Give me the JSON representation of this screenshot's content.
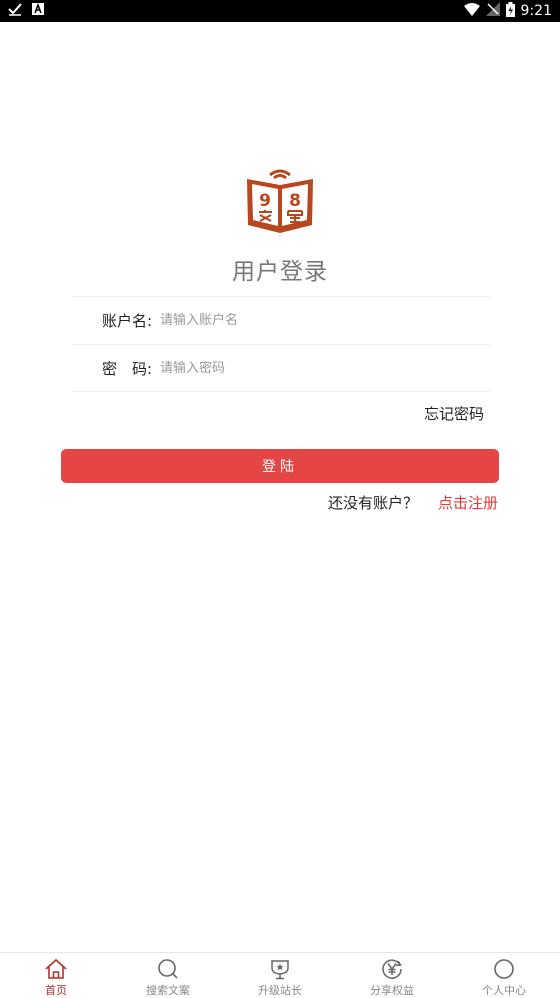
{
  "status_bar": {
    "time": "9:21"
  },
  "page": {
    "title": "用户登录"
  },
  "form": {
    "username_label": "账户名:",
    "username_placeholder": "请输入账户名",
    "password_label": "密　码:",
    "password_placeholder": "请输入密码",
    "forgot_label": "忘记密码",
    "login_label": "登陆",
    "register_prompt": "还没有账户？",
    "register_link": "点击注册"
  },
  "tabs": [
    {
      "label": "首页",
      "icon": "home-icon",
      "active": true
    },
    {
      "label": "搜索文案",
      "icon": "search-icon",
      "active": false
    },
    {
      "label": "升级站长",
      "icon": "trophy-icon",
      "active": false
    },
    {
      "label": "分享权益",
      "icon": "yen-icon",
      "active": false
    },
    {
      "label": "个人中心",
      "icon": "user-circle-icon",
      "active": false
    }
  ],
  "colors": {
    "accent": "#e54545",
    "logo": "#b8461f",
    "tab_active": "#b5312b"
  }
}
